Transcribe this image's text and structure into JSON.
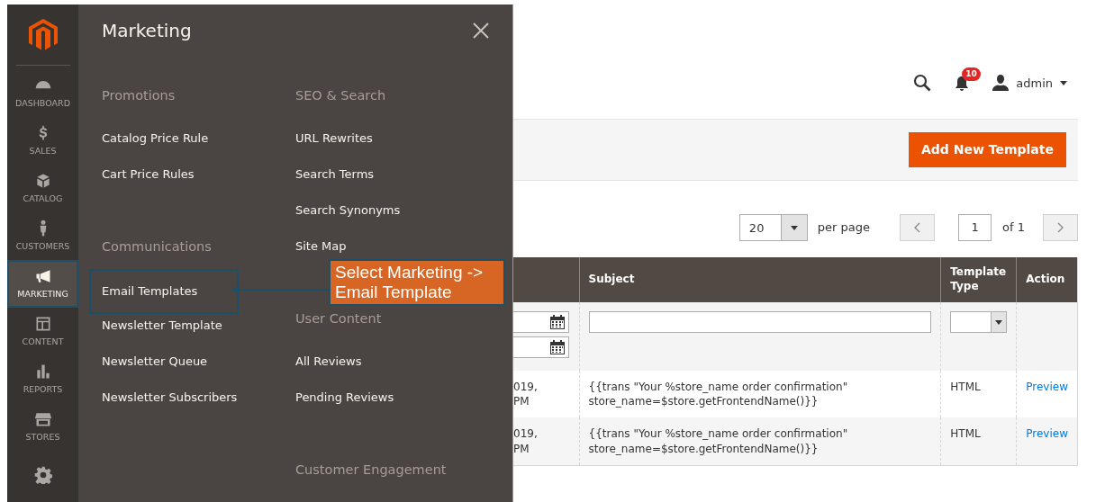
{
  "sidebar": {
    "items": [
      {
        "label": "DASHBOARD",
        "selected": false,
        "highlighted": false
      },
      {
        "label": "SALES",
        "selected": false,
        "highlighted": false
      },
      {
        "label": "CATALOG",
        "selected": false,
        "highlighted": false
      },
      {
        "label": "CUSTOMERS",
        "selected": false,
        "highlighted": false
      },
      {
        "label": "MARKETING",
        "selected": true,
        "highlighted": true
      },
      {
        "label": "CONTENT",
        "selected": false,
        "highlighted": false
      },
      {
        "label": "REPORTS",
        "selected": false,
        "highlighted": false
      },
      {
        "label": "STORES",
        "selected": false,
        "highlighted": false
      },
      {
        "selected": false,
        "highlighted": false
      }
    ]
  },
  "menu": {
    "title": "Marketing",
    "columns": [
      [
        {
          "heading": "Promotions",
          "items": [
            {
              "label": "Catalog Price Rule",
              "highlighted": false
            },
            {
              "label": "Cart Price Rules",
              "highlighted": false
            }
          ]
        },
        {
          "heading": "Communications",
          "items": [
            {
              "label": "Email Templates",
              "highlighted": true
            },
            {
              "label": "Newsletter Template",
              "highlighted": false
            },
            {
              "label": "Newsletter Queue",
              "highlighted": false
            },
            {
              "label": "Newsletter Subscribers",
              "highlighted": false
            }
          ]
        }
      ],
      [
        {
          "heading": "SEO & Search",
          "items": [
            {
              "label": "URL Rewrites",
              "highlighted": false
            },
            {
              "label": "Search Terms",
              "highlighted": false
            },
            {
              "label": "Search Synonyms",
              "highlighted": false
            },
            {
              "label": "Site Map",
              "highlighted": false
            }
          ]
        },
        {
          "heading": "User Content",
          "items": [
            {
              "label": "All Reviews",
              "highlighted": false
            },
            {
              "label": "Pending Reviews",
              "highlighted": false
            }
          ]
        },
        {
          "heading": "Customer Engagement"
        }
      ]
    ]
  },
  "callout": {
    "lines": [
      "Select Marketing ->",
      "Email Template"
    ]
  },
  "header": {
    "notifications": "10",
    "user": "admin"
  },
  "actions": {
    "add_button": "Add New Template"
  },
  "pagination": {
    "per_page_value": "20",
    "per_page_label": "per page",
    "page": "1",
    "of": "of 1"
  },
  "table": {
    "columns": [
      "Subject",
      [
        "Template",
        "Type"
      ],
      "Action"
    ],
    "rows": [
      {
        "column_1": [
          "019,",
          "PM"
        ],
        "subject": [
          "{{trans \"Your %store_name order confirmation\"",
          "store_name=$store.getFrontendName()}}"
        ],
        "type": "HTML",
        "action": "Preview"
      },
      {
        "column_1": [
          "019,",
          "PM"
        ],
        "subject": [
          "{{trans \"Your %store_name order confirmation\"",
          "store_name=$store.getFrontendName()}}"
        ],
        "type": "HTML",
        "action": "Preview"
      }
    ]
  }
}
